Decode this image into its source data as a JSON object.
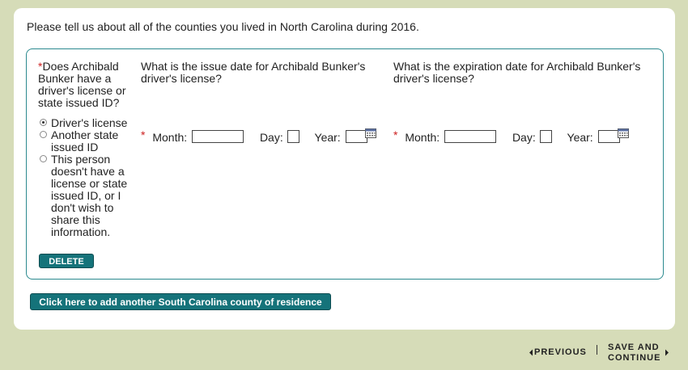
{
  "intro": "Please tell us about all of the counties you lived in North Carolina during 2016.",
  "license_question": {
    "required_mark": "*",
    "text": "Does Archibald Bunker have a driver's license or state issued ID?"
  },
  "license_options": [
    {
      "label": "Driver's license",
      "checked": true
    },
    {
      "label": "Another state issued ID",
      "checked": false
    },
    {
      "label": "This person doesn't have a license or state issued ID, or I don't wish to share this information.",
      "checked": false
    }
  ],
  "delete_label": "DELETE",
  "issue_date": {
    "question": "What is the issue date for Archibald Bunker's driver's license?",
    "required_mark": "*",
    "month_label": "Month:",
    "day_label": "Day:",
    "year_label": "Year:",
    "month_value": "",
    "day_value": "",
    "year_value": ""
  },
  "expiration_date": {
    "question": "What is the expiration date for Archibald Bunker's driver's license?",
    "required_mark": "*",
    "month_label": "Month:",
    "day_label": "Day:",
    "year_label": "Year:",
    "month_value": "",
    "day_value": "",
    "year_value": ""
  },
  "add_county_label": "Click here to add another South Carolina county of residence",
  "nav": {
    "previous_label": "PREVIOUS",
    "save_line1": "SAVE AND",
    "save_line2": "CONTINUE"
  },
  "icons": {
    "calendar": "calendar-icon",
    "previous": "chevron-left-icon",
    "next": "chevron-right-icon"
  },
  "colors": {
    "background": "#d6dcb8",
    "accent": "#15737a",
    "box_border": "#2b8a8f",
    "required": "#cc1f1f"
  }
}
